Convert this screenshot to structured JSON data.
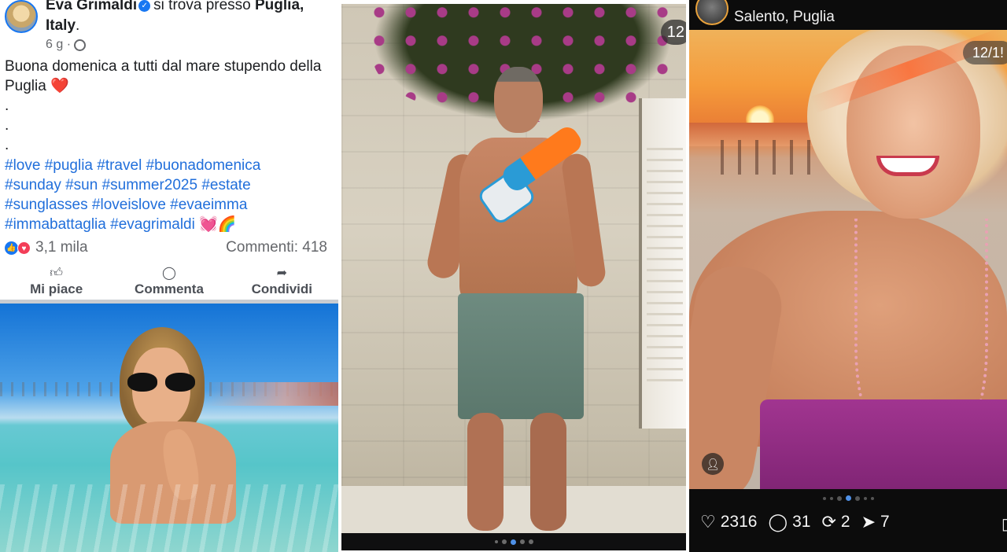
{
  "facebook": {
    "author": "Eva Grimaldi",
    "location_text": "si trova presso",
    "location": "Puglia, Italy",
    "location_end": ".",
    "time": "6 g ·",
    "caption": "Buona domenica a tutti dal mare stupendo della Puglia",
    "caption_emoji": "❤️",
    "dot_lines": [
      ".",
      ".",
      "."
    ],
    "hashtags": [
      "#love #puglia #travel #buonadomenica",
      "#sunday #sun #summer2025 #estate",
      "#sunglasses #loveislove #evaeimma",
      "#immabattaglia #evagrimaldi"
    ],
    "hashtag_emoji": "💓🌈",
    "reactions_count": "3,1 mila",
    "comments": "Commenti: 418",
    "actions": {
      "like": "Mi piace",
      "comment": "Commenta",
      "share": "Condividi"
    }
  },
  "instagram": {
    "counter": "12",
    "page_dots": 5,
    "active_dot": 2
  },
  "threads": {
    "location": "Salento, Puglia",
    "counter": "12/1!",
    "page_dots": 7,
    "active_dot": 3,
    "likes": "2316",
    "comments": "31",
    "reposts": "2",
    "shares": "7"
  },
  "colors": {
    "facebook_blue": "#1877f2",
    "hashtag_blue": "#216fdb",
    "threads_background": "#0c0c0c"
  }
}
